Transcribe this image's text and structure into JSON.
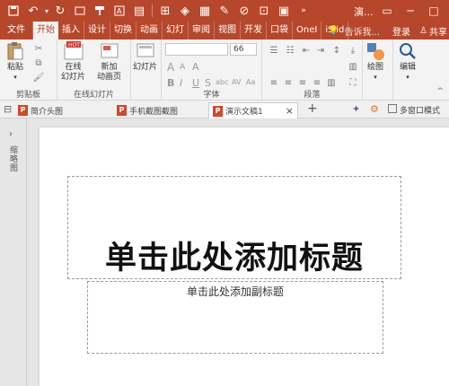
{
  "window": {
    "title": "演...",
    "accent_color": "#b7472a"
  },
  "tabs": {
    "items": [
      {
        "label": "文件"
      },
      {
        "label": "开始"
      },
      {
        "label": "插入"
      },
      {
        "label": "设计"
      },
      {
        "label": "切换"
      },
      {
        "label": "动画"
      },
      {
        "label": "幻灯"
      },
      {
        "label": "审阅"
      },
      {
        "label": "视图"
      },
      {
        "label": "开发"
      },
      {
        "label": "口袋"
      },
      {
        "label": "OneI"
      },
      {
        "label": "iSlid"
      }
    ],
    "tell_me": "告诉我...",
    "login": "登录",
    "share": "共享"
  },
  "ribbon": {
    "clipboard": {
      "paste": "粘贴",
      "label": "剪贴板"
    },
    "online_slides": {
      "online": "在线",
      "online2": "幻灯片",
      "new": "新加",
      "new2": "动画页",
      "label": "在线幻灯片"
    },
    "slides": {
      "slide": "幻灯片"
    },
    "font": {
      "size_value": "66",
      "label": "字体",
      "bold": "B",
      "italic": "I",
      "underline": "U",
      "strike": "S",
      "shadow": "abc",
      "spacing": "AV",
      "case": "Aa",
      "size_up": "A",
      "size_down": "A",
      "clear": "A"
    },
    "paragraph": {
      "label": "段落"
    },
    "drawing": {
      "label": "绘图"
    },
    "editing": {
      "label": "编辑"
    }
  },
  "doctabs": {
    "items": [
      {
        "label": "简介头图"
      },
      {
        "label": "手机截图截图"
      },
      {
        "label": "演示文稿1"
      }
    ],
    "close": "×",
    "add": "+",
    "multi_window": "多窗口模式"
  },
  "sidepanel": {
    "label": "缩略图"
  },
  "slide": {
    "title_placeholder": "单击此处添加标题",
    "subtitle_placeholder": "单击此处添加副标题"
  }
}
